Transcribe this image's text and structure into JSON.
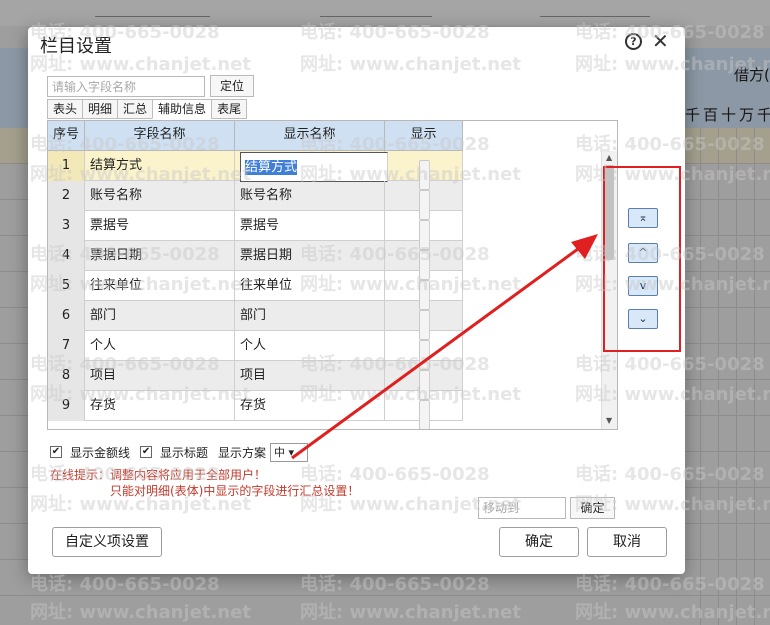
{
  "background": {
    "header_label": "借方(",
    "header_digits": "千百十万千"
  },
  "watermark": {
    "phone": "电话: 400-665-0028",
    "site": "网址: www.chanjet.net"
  },
  "dialog": {
    "title": "栏目设置",
    "help_icon": "help-icon",
    "close_icon": "close-icon",
    "search": {
      "placeholder": "请输入字段名称",
      "value": ""
    },
    "locate_label": "定位",
    "tabs": [
      {
        "label": "表头"
      },
      {
        "label": "明细"
      },
      {
        "label": "汇总"
      },
      {
        "label": "辅助信息",
        "active": true
      },
      {
        "label": "表尾"
      }
    ],
    "grid": {
      "columns": [
        "序号",
        "字段名称",
        "显示名称",
        "显示"
      ],
      "rows": [
        {
          "seq": "1",
          "field": "结算方式",
          "display": "结算方式",
          "show": false,
          "selected": true
        },
        {
          "seq": "2",
          "field": "账号名称",
          "display": "账号名称",
          "show": false
        },
        {
          "seq": "3",
          "field": "票据号",
          "display": "票据号",
          "show": false
        },
        {
          "seq": "4",
          "field": "票据日期",
          "display": "票据日期",
          "show": false
        },
        {
          "seq": "5",
          "field": "往来单位",
          "display": "往来单位",
          "show": false
        },
        {
          "seq": "6",
          "field": "部门",
          "display": "部门",
          "show": false
        },
        {
          "seq": "7",
          "field": "个人",
          "display": "个人",
          "show": false
        },
        {
          "seq": "8",
          "field": "项目",
          "display": "项目",
          "show": false
        },
        {
          "seq": "9",
          "field": "存货",
          "display": "存货",
          "show": false
        }
      ]
    },
    "move_buttons": [
      {
        "name": "move-top-button",
        "glyph": "⌅"
      },
      {
        "name": "move-up-button",
        "glyph": "^"
      },
      {
        "name": "move-down-button",
        "glyph": "v"
      },
      {
        "name": "move-bottom-button",
        "glyph": "⌄"
      }
    ],
    "options": {
      "show_amount_lines": {
        "label": "显示金额线",
        "checked": true
      },
      "show_title": {
        "label": "显示标题",
        "checked": true
      },
      "scheme_label": "显示方案",
      "scheme_value": "中"
    },
    "tips": {
      "line1": "在线提示：调整内容将应用于全部用户！",
      "line2": "只能对明细(表体)中显示的字段进行汇总设置！"
    },
    "moveto": {
      "placeholder": "移动到",
      "ok_label": "确定"
    },
    "buttons": {
      "custom": "自定义项设置",
      "ok": "确定",
      "cancel": "取消"
    }
  },
  "colors": {
    "accent_header": "#cfe0f3",
    "selected_row": "#fbf3cc",
    "annotation_red": "#e02020",
    "tip_text": "#c0392b"
  }
}
